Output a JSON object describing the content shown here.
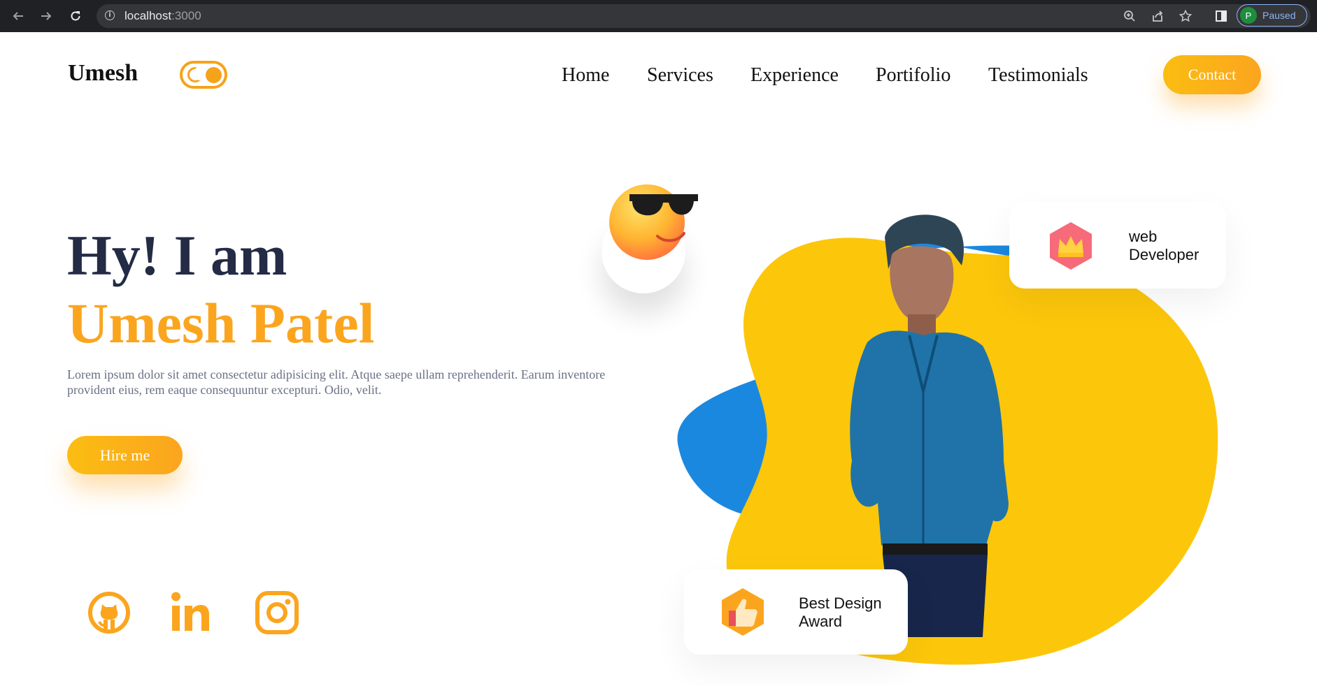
{
  "browser": {
    "url_host": "localhost",
    "url_port": ":3000",
    "profile_initial": "P",
    "profile_status": "Paused",
    "icons": [
      "back-arrow-icon",
      "forward-arrow-icon",
      "reload-icon",
      "info-icon",
      "zoom-icon",
      "share-icon",
      "star-icon",
      "side-panel-icon"
    ]
  },
  "header": {
    "logo": "Umesh",
    "nav": [
      "Home",
      "Services",
      "Experience",
      "Portifolio",
      "Testimonials"
    ],
    "contact_label": "Contact"
  },
  "hero": {
    "greeting": "Hy! I am",
    "name": "Umesh Patel",
    "description": "Lorem ipsum dolor sit amet consectetur adipisicing elit. Atque saepe ullam reprehenderit. Earum inventore provident eius, rem eaque consequuntur excepturi. Odio, velit.",
    "hire_label": "Hire me"
  },
  "social": [
    "github-icon",
    "linkedin-icon",
    "instagram-icon"
  ],
  "cards": {
    "web": {
      "line1": "web",
      "line2": "Developer",
      "icon": "crown-icon"
    },
    "award": {
      "line1": "Best Design",
      "line2": "Award",
      "icon": "thumbs-up-icon"
    }
  },
  "colors": {
    "accent": "#fba51f",
    "heading": "#232b45",
    "blob_yellow": "#fcc60b",
    "blob_blue": "#1b88e0"
  }
}
